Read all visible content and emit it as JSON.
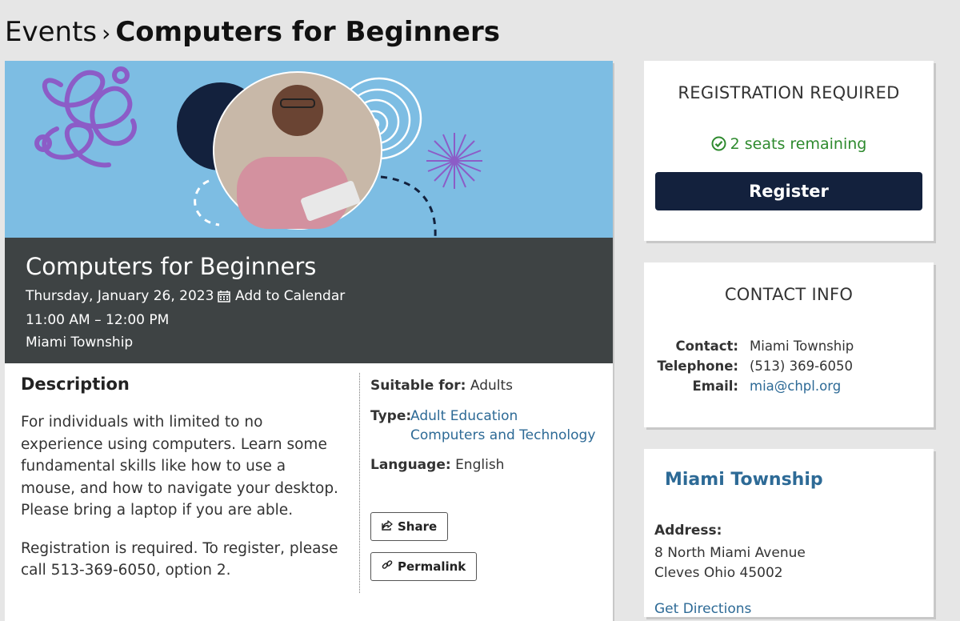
{
  "breadcrumb": {
    "parent": "Events",
    "separator": "›",
    "current": "Computers for Beginners"
  },
  "event": {
    "title": "Computers for Beginners",
    "date": "Thursday, January 26, 2023",
    "add_to_calendar": "Add to Calendar",
    "time": "11:00 AM – 12:00 PM",
    "location": "Miami Township",
    "banner_icon": "illustration-man-with-tablet"
  },
  "description": {
    "heading": "Description",
    "paragraphs": [
      "For individuals with limited to no experience using computers. Learn some fundamental skills like how to use a mouse, and how to navigate your desktop. Please bring a laptop if you are able.",
      "Registration is required. To register, please call 513-369-6050, option 2."
    ]
  },
  "meta": {
    "suitable_label": "Suitable for:",
    "suitable_value": "Adults",
    "type_label": "Type:",
    "types": [
      "Adult Education",
      "Computers and Technology"
    ],
    "language_label": "Language:",
    "language_value": "English",
    "share_label": "Share",
    "permalink_label": "Permalink"
  },
  "registration": {
    "heading": "REGISTRATION REQUIRED",
    "seats": "2 seats remaining",
    "register_label": "Register"
  },
  "contact": {
    "heading": "CONTACT INFO",
    "rows": [
      {
        "key": "Contact:",
        "value": "Miami Township"
      },
      {
        "key": "Telephone:",
        "value": "(513) 369-6050"
      },
      {
        "key": "Email:",
        "value": "mia@chpl.org"
      }
    ]
  },
  "location_card": {
    "title": "Miami Township",
    "address_label": "Address:",
    "address_lines": [
      "8 North Miami Avenue",
      "Cleves Ohio 45002"
    ],
    "directions": "Get Directions"
  },
  "colors": {
    "banner": "#7dbde3",
    "title_band": "#3e4344",
    "register_button": "#13213d",
    "link": "#2d6a96",
    "success": "#2e8a2e"
  }
}
